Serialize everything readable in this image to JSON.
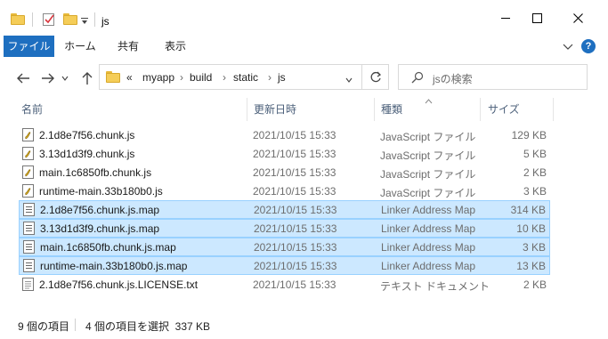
{
  "window": {
    "title": "js",
    "minimize_icon": "minimize-icon",
    "maximize_icon": "maximize-icon",
    "close_icon": "close-icon"
  },
  "ribbon": {
    "tabs": [
      {
        "label": "ファイル",
        "active": true
      },
      {
        "label": "ホーム",
        "active": false
      },
      {
        "label": "共有",
        "active": false
      },
      {
        "label": "表示",
        "active": false
      }
    ],
    "help_label": "?"
  },
  "address": {
    "overflow": "«",
    "segments": [
      "myapp",
      "build",
      "static",
      "js"
    ],
    "search_placeholder": "jsの検索"
  },
  "columns": {
    "name": "名前",
    "date": "更新日時",
    "type": "種類",
    "size": "サイズ"
  },
  "files": [
    {
      "name": "2.1d8e7f56.chunk.js",
      "date": "2021/10/15 15:33",
      "type": "JavaScript ファイル",
      "size": "129 KB",
      "icon": "javascript-file-icon",
      "selected": false
    },
    {
      "name": "3.13d1d3f9.chunk.js",
      "date": "2021/10/15 15:33",
      "type": "JavaScript ファイル",
      "size": "5 KB",
      "icon": "javascript-file-icon",
      "selected": false
    },
    {
      "name": "main.1c6850fb.chunk.js",
      "date": "2021/10/15 15:33",
      "type": "JavaScript ファイル",
      "size": "2 KB",
      "icon": "javascript-file-icon",
      "selected": false
    },
    {
      "name": "runtime-main.33b180b0.js",
      "date": "2021/10/15 15:33",
      "type": "JavaScript ファイル",
      "size": "3 KB",
      "icon": "javascript-file-icon",
      "selected": false
    },
    {
      "name": "2.1d8e7f56.chunk.js.map",
      "date": "2021/10/15 15:33",
      "type": "Linker Address Map",
      "size": "314 KB",
      "icon": "map-file-icon",
      "selected": true
    },
    {
      "name": "3.13d1d3f9.chunk.js.map",
      "date": "2021/10/15 15:33",
      "type": "Linker Address Map",
      "size": "10 KB",
      "icon": "map-file-icon",
      "selected": true
    },
    {
      "name": "main.1c6850fb.chunk.js.map",
      "date": "2021/10/15 15:33",
      "type": "Linker Address Map",
      "size": "3 KB",
      "icon": "map-file-icon",
      "selected": true
    },
    {
      "name": "runtime-main.33b180b0.js.map",
      "date": "2021/10/15 15:33",
      "type": "Linker Address Map",
      "size": "13 KB",
      "icon": "map-file-icon",
      "selected": true
    },
    {
      "name": "2.1d8e7f56.chunk.js.LICENSE.txt",
      "date": "2021/10/15 15:33",
      "type": "テキスト ドキュメント",
      "size": "2 KB",
      "icon": "text-file-icon",
      "selected": false
    }
  ],
  "status": {
    "item_count": "9 個の項目",
    "selection": "4 個の項目を選択  337 KB"
  },
  "colors": {
    "accent": "#1e6fc0",
    "selection_bg": "#cce8ff",
    "selection_border": "#99d1ff",
    "folder": "#f5cd58"
  }
}
